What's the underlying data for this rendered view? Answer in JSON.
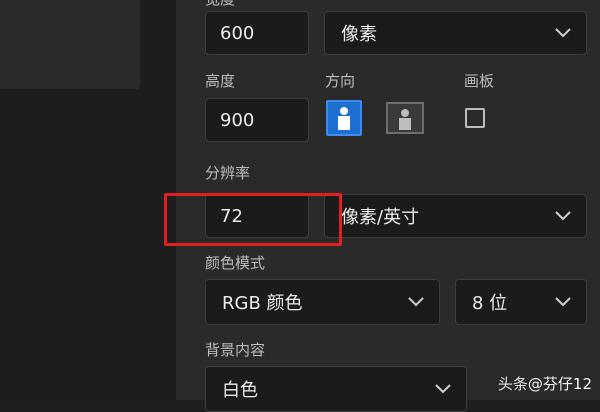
{
  "width_field": {
    "value": "600"
  },
  "width_unit": {
    "value": "像素"
  },
  "height": {
    "label": "高度",
    "value": "900"
  },
  "orientation": {
    "label": "方向",
    "portrait": "portrait",
    "landscape": "landscape"
  },
  "artboard": {
    "label": "画板",
    "checked": false
  },
  "resolution": {
    "label": "分辨率",
    "value": "72",
    "unit": "像素/英寸"
  },
  "color_mode": {
    "label": "颜色模式",
    "mode": "RGB 颜色",
    "depth": "8 位"
  },
  "background": {
    "label": "背景内容",
    "value": "白色"
  },
  "watermark": {
    "prefix": "头条",
    "text": "@芬仔12"
  },
  "colors": {
    "accent": "#1e6fd0",
    "highlight": "#e0201e"
  }
}
